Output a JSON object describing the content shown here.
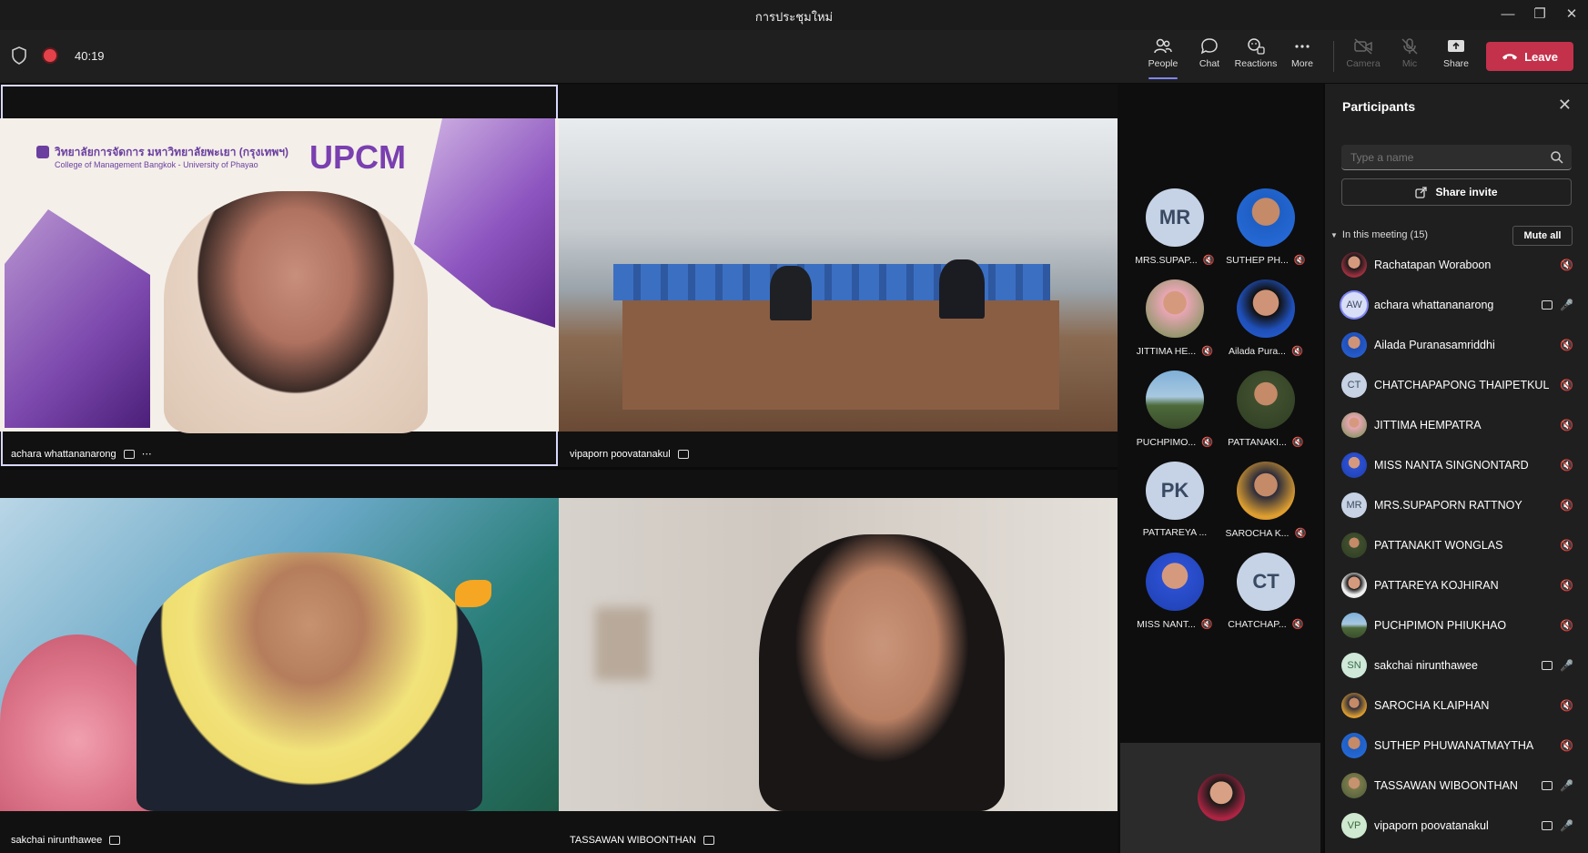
{
  "window": {
    "title": "การประชุมใหม่"
  },
  "toolbar": {
    "timer": "40:19",
    "buttons": {
      "people": "People",
      "chat": "Chat",
      "reactions": "Reactions",
      "more": "More",
      "camera": "Camera",
      "mic": "Mic",
      "share": "Share"
    },
    "leave_label": "Leave"
  },
  "stage": {
    "tiles": [
      {
        "name": "achara whattananarong",
        "background_text": "วิทยาลัยการจัดการ มหาวิทยาลัยพะเยา (กรุงเทพฯ)",
        "background_subtext": "College of Management Bangkok - University of Phayao",
        "brand": "UPCM"
      },
      {
        "name": "vipaporn poovatanakul"
      },
      {
        "name": "sakchai nirunthawee"
      },
      {
        "name": "TASSAWAN WIBOONTHAN"
      }
    ]
  },
  "gallery": [
    {
      "initials": "MR",
      "name": "MRS.SUPAP..."
    },
    {
      "initials": "",
      "name": "SUTHEP PH..."
    },
    {
      "initials": "",
      "name": "JITTIMA HE..."
    },
    {
      "initials": "",
      "name": "Ailada Pura..."
    },
    {
      "initials": "",
      "name": "PUCHPIMO..."
    },
    {
      "initials": "",
      "name": "PATTANAKI..."
    },
    {
      "initials": "PK",
      "name": "PATTAREYA ..."
    },
    {
      "initials": "",
      "name": "SAROCHA K..."
    },
    {
      "initials": "",
      "name": "MISS NANT..."
    },
    {
      "initials": "CT",
      "name": "CHATCHAP..."
    }
  ],
  "panel": {
    "title": "Participants",
    "search_placeholder": "Type a name",
    "share_invite": "Share invite",
    "in_meeting_label": "In this meeting (15)",
    "mute_all": "Mute all",
    "participants": [
      {
        "initials": "",
        "name": "Rachatapan Woraboon"
      },
      {
        "initials": "AW",
        "name": "achara whattananarong"
      },
      {
        "initials": "",
        "name": "Ailada Puranasamriddhi"
      },
      {
        "initials": "CT",
        "name": "CHATCHAPAPONG THAIPETKUL"
      },
      {
        "initials": "",
        "name": "JITTIMA HEMPATRA"
      },
      {
        "initials": "",
        "name": "MISS NANTA SINGNONTARD"
      },
      {
        "initials": "MR",
        "name": "MRS.SUPAPORN RATTNOY"
      },
      {
        "initials": "",
        "name": "PATTANAKIT WONGLAS"
      },
      {
        "initials": "",
        "name": "PATTAREYA KOJHIRAN"
      },
      {
        "initials": "",
        "name": "PUCHPIMON PHIUKHAO"
      },
      {
        "initials": "SN",
        "name": "sakchai nirunthawee"
      },
      {
        "initials": "",
        "name": "SAROCHA KLAIPHAN"
      },
      {
        "initials": "",
        "name": "SUTHEP PHUWANATMAYTHA"
      },
      {
        "initials": "",
        "name": "TASSAWAN WIBOONTHAN"
      },
      {
        "initials": "VP",
        "name": "vipaporn poovatanakul"
      }
    ]
  }
}
